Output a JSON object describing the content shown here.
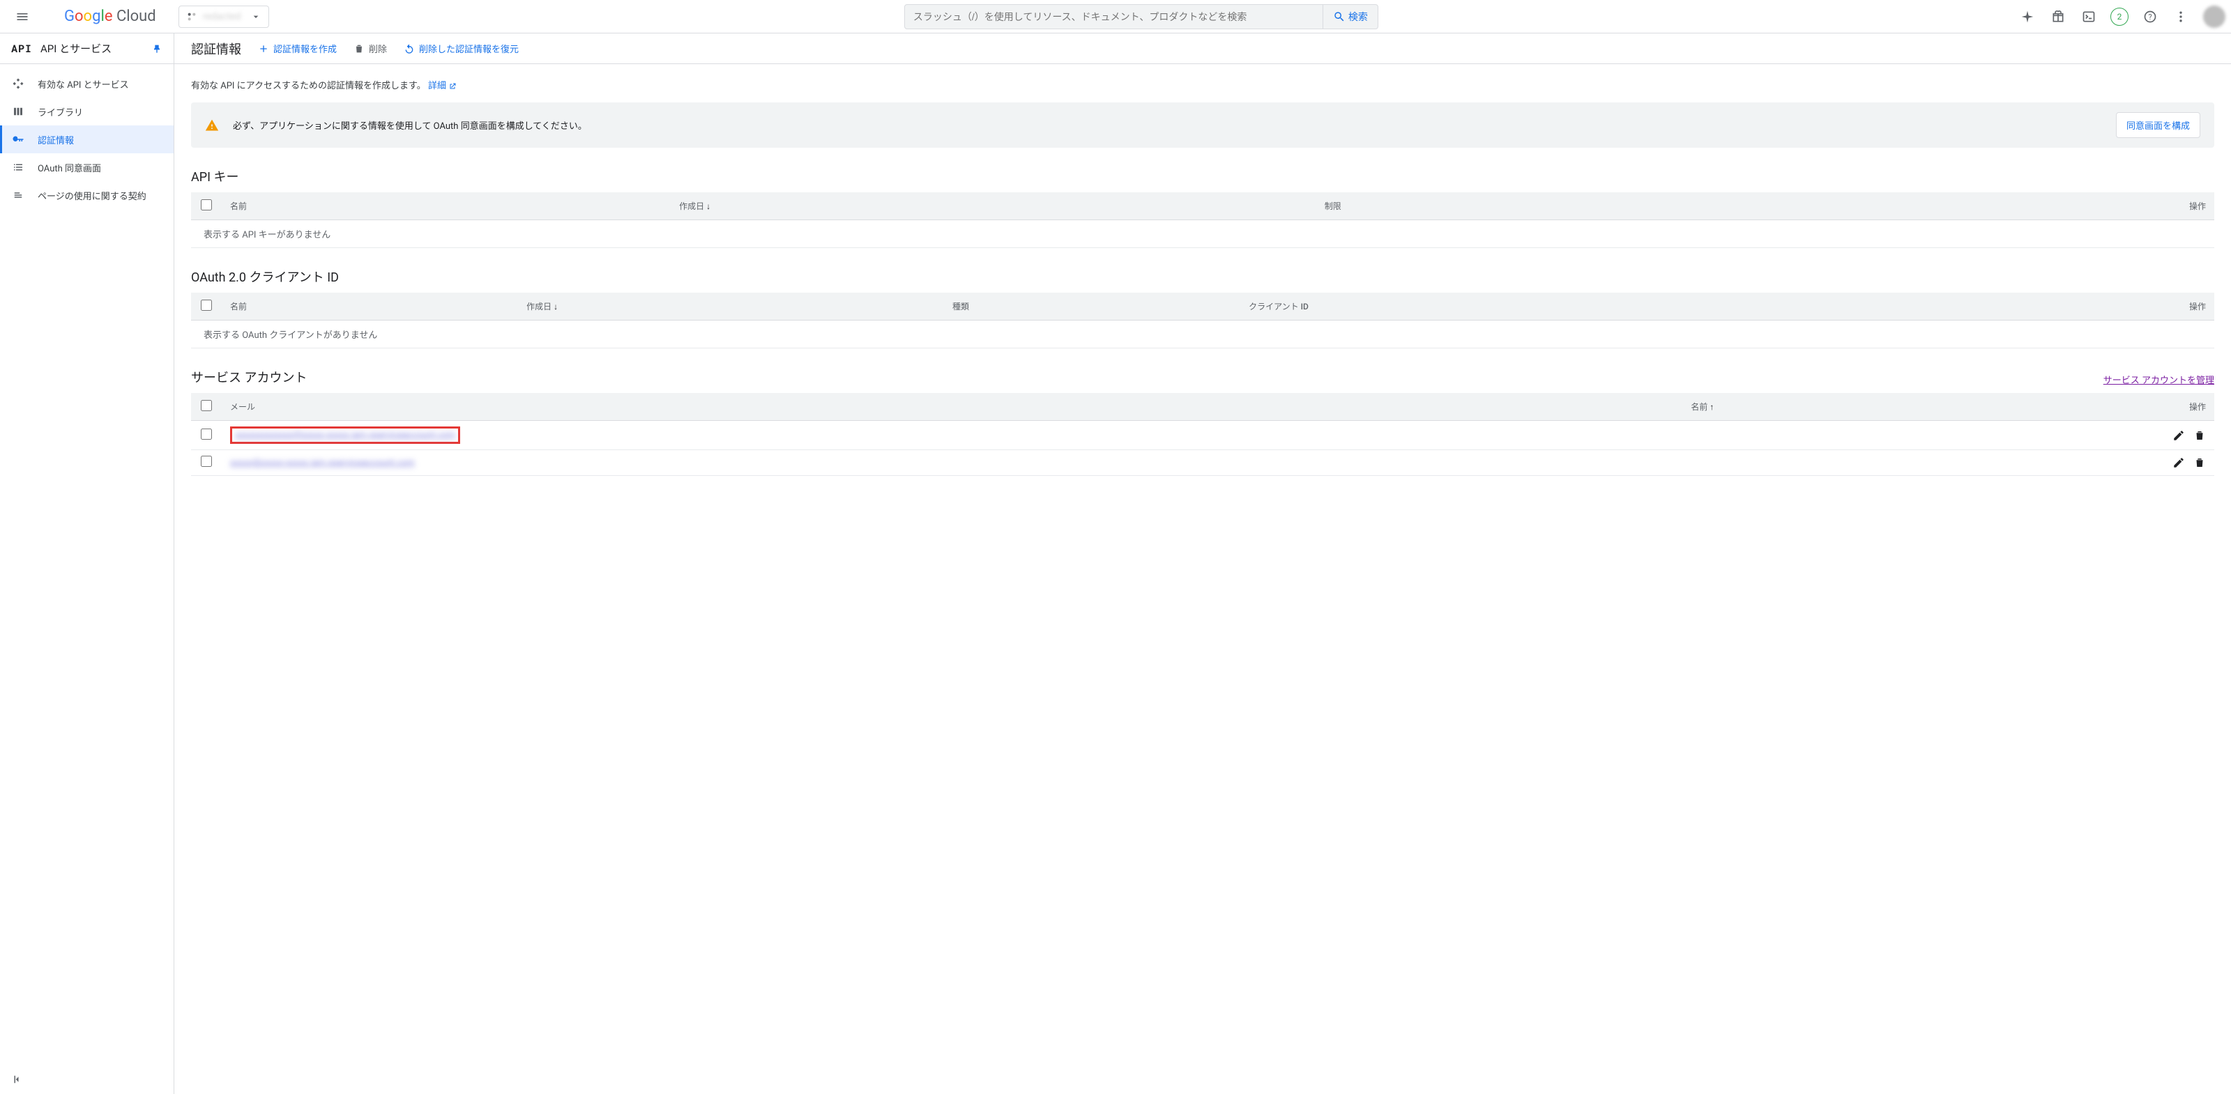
{
  "header": {
    "brand": "Google Cloud",
    "project_name": "redacted",
    "search_placeholder": "スラッシュ（/）を使用してリソース、ドキュメント、プロダクトなどを検索",
    "search_button": "検索",
    "trial_badge": "2"
  },
  "sidebar": {
    "logo": "API",
    "title": "API とサービス",
    "items": [
      {
        "label": "有効な API とサービス"
      },
      {
        "label": "ライブラリ"
      },
      {
        "label": "認証情報"
      },
      {
        "label": "OAuth 同意画面"
      },
      {
        "label": "ページの使用に関する契約"
      }
    ]
  },
  "page": {
    "title": "認証情報",
    "actions": {
      "create": "認証情報を作成",
      "delete": "削除",
      "restore": "削除した認証情報を復元"
    },
    "help_text": "有効な API にアクセスするための認証情報を作成します。",
    "help_link": "詳細",
    "alert": {
      "text": "必ず、アプリケーションに関する情報を使用して OAuth 同意画面を構成してください。",
      "button": "同意画面を構成"
    }
  },
  "sections": {
    "api_keys": {
      "title": "API キー",
      "cols": {
        "name": "名前",
        "created": "作成日",
        "restriction": "制限",
        "ops": "操作"
      },
      "empty": "表示する API キーがありません"
    },
    "oauth": {
      "title": "OAuth 2.0 クライアント ID",
      "cols": {
        "name": "名前",
        "created": "作成日",
        "type": "種類",
        "client_id": "クライアント ID",
        "ops": "操作"
      },
      "empty": "表示する OAuth クライアントがありません"
    },
    "service_accounts": {
      "title": "サービス アカウント",
      "manage_link": "サービス アカウントを管理",
      "cols": {
        "email": "メール",
        "name": "名前",
        "ops": "操作"
      },
      "rows": [
        {
          "email": "xxxxxxxxxxxxx@xxxxx-xxxxx.iam.gserviceaccount.com",
          "highlighted": true
        },
        {
          "email": "xxxxx@xxxxx-xxxxx.iam.gserviceaccount.com",
          "highlighted": false
        }
      ]
    }
  }
}
